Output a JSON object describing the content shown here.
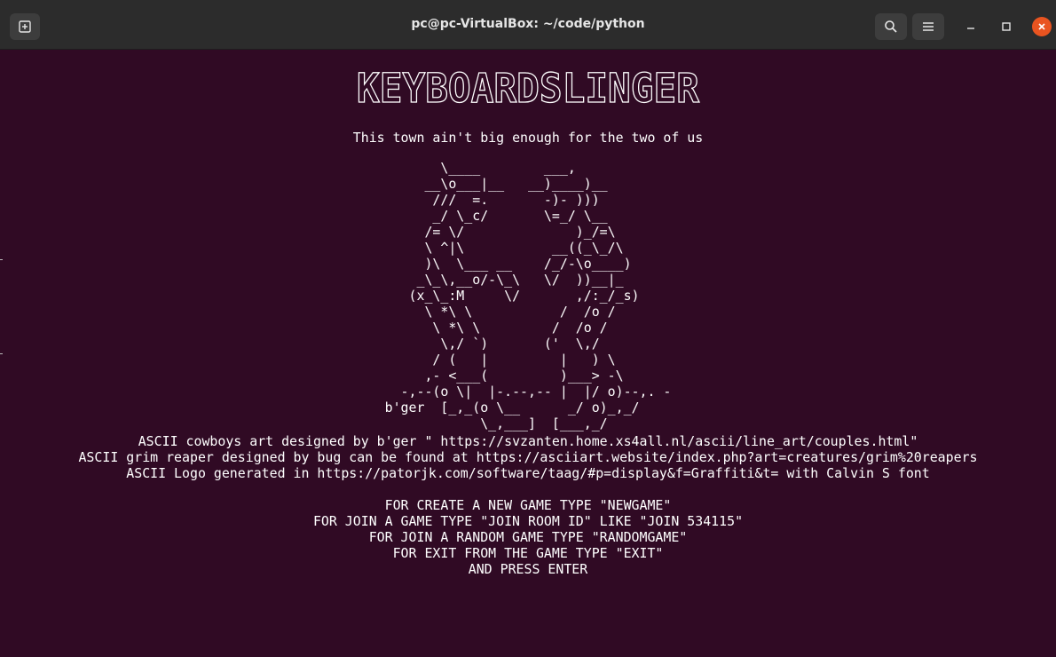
{
  "window": {
    "title": "pc@pc-VirtualBox: ~/code/python"
  },
  "icons": {
    "new_tab": "new-tab-icon",
    "search": "search-icon",
    "menu": "hamburger-menu-icon",
    "minimize": "minimize-icon",
    "maximize": "maximize-icon",
    "close": "close-icon"
  },
  "colors": {
    "terminal_bg": "#300a24",
    "titlebar_bg": "#2c2c2c",
    "close_button": "#e95420",
    "text": "#ffffff"
  },
  "terminal": {
    "logo_text": "KEYBOARDSLINGER",
    "tagline": "This town ain't big enough for the two of us",
    "art_lines": [
      "       \\____        ___,",
      "     __\\o___|__   __)____)__",
      "      ///  =.       -)- )))",
      "      _/ \\_c/       \\=_/ \\__",
      "     /= \\/              )_/=\\",
      "     \\ ^|\\           __((_\\_/\\",
      "     )\\  \\___ __    /_/-\\o____)",
      "    _\\_\\,__o/-\\_\\   \\/  ))__|_",
      "   (x_\\_:M     \\/       ,/:_/_s)",
      "     \\ *\\ \\           /  /o /",
      "      \\ *\\ \\         /  /o /",
      "       \\,/ `)       ('  \\,/",
      "      / (   |         |   ) \\",
      "     ,- <___(         )___> -\\",
      "  -,--(o \\|  |-.--,-- |  |/ o)--,. -",
      "b'ger  [_,_(o \\__      _/ o)_,_/",
      "            \\_,___]  [___,_/"
    ],
    "credits": [
      "ASCII cowboys art designed by b'ger \" https://svzanten.home.xs4all.nl/ascii/line_art/couples.html\"",
      "ASCII grim reaper designed by bug can be found at https://asciiart.website/index.php?art=creatures/grim%20reapers",
      "ASCII Logo generated in https://patorjk.com/software/taag/#p=display&f=Graffiti&t= with Calvin S font"
    ],
    "instructions": [
      "FOR CREATE A NEW GAME TYPE \"NEWGAME\"",
      "FOR JOIN A GAME TYPE \"JOIN ROOM ID\" LIKE \"JOIN 534115\"",
      "FOR JOIN A RANDOM GAME TYPE \"RANDOMGAME\"",
      "FOR EXIT FROM THE GAME TYPE \"EXIT\"",
      "AND PRESS ENTER"
    ]
  }
}
